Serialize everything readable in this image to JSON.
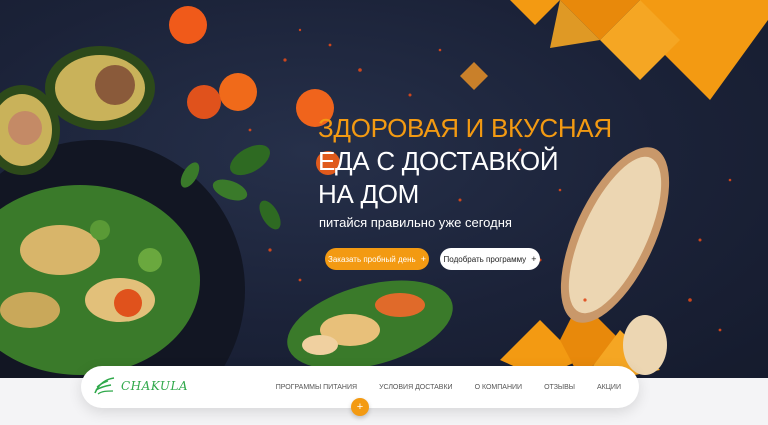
{
  "hero": {
    "headline_line1": "ЗДОРОВАЯ И ВКУСНАЯ",
    "headline_line2": "ЕДА С ДОСТАВКОЙ",
    "headline_line3": "НА ДОМ",
    "subtitle": "питайся правильно уже сегодня",
    "primary_button": "Заказать пробный день",
    "secondary_button": "Подобрать программу",
    "button_plus": "+"
  },
  "navbar": {
    "logo_text": "CHAKULA",
    "menu": [
      "ПРОГРАММЫ ПИТАНИЯ",
      "УСЛОВИЯ ДОСТАВКИ",
      "О КОМПАНИИ",
      "ОТЗЫВЫ",
      "АКЦИИ"
    ]
  },
  "scroll_button": "+",
  "colors": {
    "accent": "#f39a12",
    "background": "#1b2238",
    "brand_green": "#2fa84a"
  }
}
